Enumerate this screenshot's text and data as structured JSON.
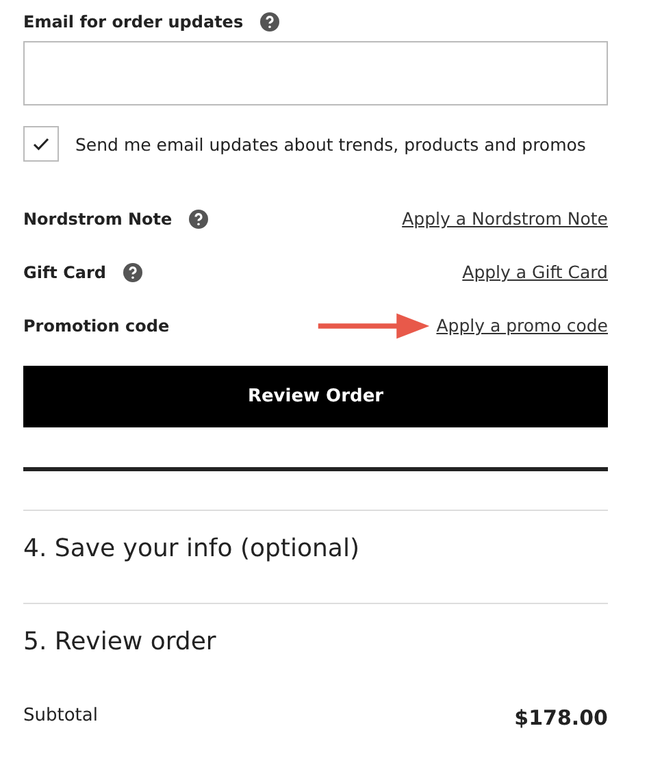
{
  "email": {
    "label": "Email for order updates",
    "help": true
  },
  "subscribe": {
    "label": "Send me email updates about trends, products and promos",
    "checked": true
  },
  "options": [
    {
      "label": "Nordstrom Note",
      "help": true,
      "link": "Apply a Nordstrom Note",
      "arrow": false
    },
    {
      "label": "Gift Card",
      "help": true,
      "link": "Apply a Gift Card",
      "arrow": false
    },
    {
      "label": "Promotion code",
      "help": false,
      "link": "Apply a promo code",
      "arrow": true
    }
  ],
  "primary_button": "Review Order",
  "steps": [
    {
      "title": "4. Save your info (optional)"
    },
    {
      "title": "5. Review order"
    }
  ],
  "subtotal": {
    "label": "Subtotal",
    "amount": "$178.00"
  }
}
